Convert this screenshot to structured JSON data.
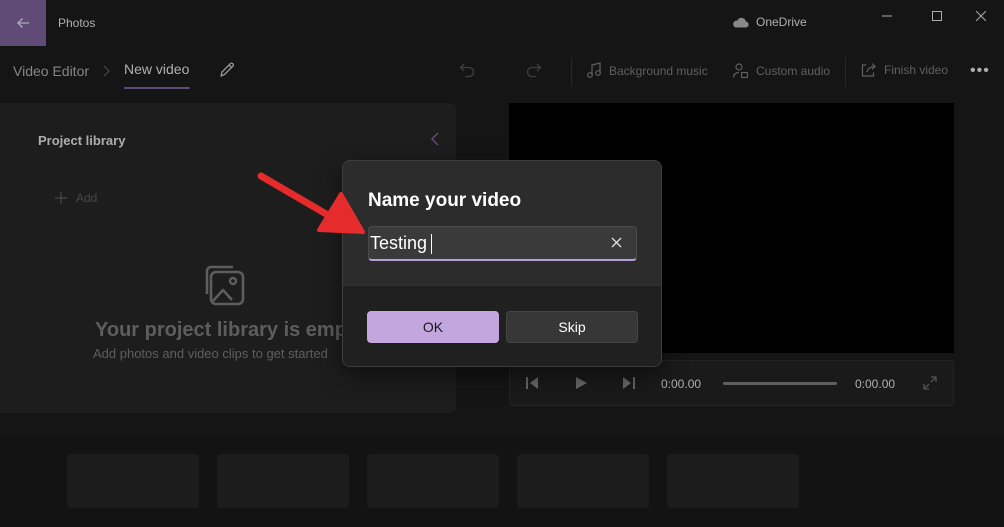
{
  "app": {
    "title": "Photos",
    "cloud_label": "OneDrive"
  },
  "colors": {
    "accent": "#8e6fb0",
    "primary_button": "#c3a6dd",
    "annotation_arrow": "#e52b2b"
  },
  "toolbar": {
    "breadcrumb_root": "Video Editor",
    "breadcrumb_current": "New video",
    "background_music": "Background music",
    "custom_audio": "Custom audio",
    "finish_video": "Finish video",
    "more": "•••"
  },
  "library": {
    "title": "Project library",
    "add_label": "Add",
    "empty_title": "Your project library is empty",
    "empty_subtitle": "Add photos and video clips to get started"
  },
  "player": {
    "current_time": "0:00.00",
    "total_time": "0:00.00"
  },
  "dialog": {
    "title": "Name your video",
    "input_value": "Testing",
    "ok_label": "OK",
    "skip_label": "Skip"
  },
  "icons": [
    "back-arrow-icon",
    "cloud-icon",
    "minimize-icon",
    "maximize-icon",
    "close-icon",
    "chevron-right-icon",
    "pencil-icon",
    "undo-icon",
    "redo-icon",
    "music-note-icon",
    "person-audio-icon",
    "share-export-icon",
    "chevron-left-icon",
    "plus-icon",
    "photos-icon",
    "prev-frame-icon",
    "play-icon",
    "next-frame-icon",
    "fullscreen-icon",
    "clear-icon"
  ]
}
